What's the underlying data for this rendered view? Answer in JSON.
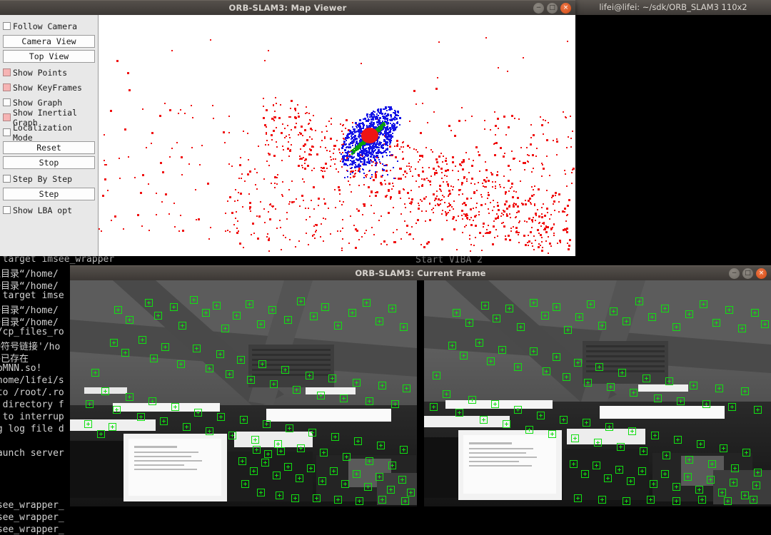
{
  "terminal": {
    "title": "lifei@lifei: ~/sdk/ORB_SLAM3 110x2",
    "lines": [
      ": target imsee_wrapper",
      "入目录“/home/",
      "开目录“/home/",
      ": target imse",
      "开目录“/home/",
      "开目录“/home/",
      "s/cp_files_ro",
      "接符号链接'/ho",
      "件已存在",
      ".bMNN.so!",
      "/home/lifei/s",
      " to /root/.ro",
      "g directory f",
      ": to interrup",
      "ng log file d",
      "Launch server",
      "msee_wrapper_",
      "msee_wrapper_",
      "msee_wrapper_"
    ],
    "background_text": "Start VIBA 2"
  },
  "map_viewer": {
    "title": "ORB-SLAM3: Map Viewer",
    "window_buttons": [
      "minimize",
      "maximize",
      "close"
    ],
    "controls": [
      {
        "type": "checkbox",
        "name": "follow-camera",
        "label": "Follow Camera",
        "checked": false
      },
      {
        "type": "button",
        "name": "camera-view",
        "label": "Camera View"
      },
      {
        "type": "button",
        "name": "top-view",
        "label": "Top View"
      },
      {
        "type": "checkbox",
        "name": "show-points",
        "label": "Show Points",
        "checked": true
      },
      {
        "type": "checkbox",
        "name": "show-keyframes",
        "label": "Show KeyFrames",
        "checked": true
      },
      {
        "type": "checkbox",
        "name": "show-graph",
        "label": "Show Graph",
        "checked": false
      },
      {
        "type": "checkbox",
        "name": "show-inertial-graph",
        "label": "Show Inertial Graph",
        "checked": true
      },
      {
        "type": "checkbox",
        "name": "localization-mode",
        "label": "Localization Mode",
        "checked": false
      },
      {
        "type": "button",
        "name": "reset",
        "label": "Reset"
      },
      {
        "type": "button",
        "name": "stop",
        "label": "Stop"
      },
      {
        "type": "checkbox",
        "name": "step-by-step",
        "label": "Step By Step",
        "checked": false
      },
      {
        "type": "button",
        "name": "step",
        "label": "Step"
      },
      {
        "type": "checkbox",
        "name": "show-lba-opt",
        "label": "Show LBA opt",
        "checked": false
      }
    ],
    "colors": {
      "map_point": "#f01010",
      "keyframe": "#1414e6",
      "graph_edge": "#08a008",
      "current_camera": "#ef1414",
      "canvas_background": "#ffffff",
      "panel_background": "#e8e8e8",
      "checkbox_checked": "#f6b4b4"
    }
  },
  "current_frame": {
    "title": "ORB-SLAM3: Current Frame",
    "window_buttons": [
      "minimize",
      "maximize",
      "close"
    ],
    "views": [
      {
        "name": "left-camera-view"
      },
      {
        "name": "right-camera-view"
      }
    ],
    "keypoint_color": "#11e011",
    "scene": "office ceiling with fluorescent lights and monitors"
  },
  "titlebar_colors": {
    "active_gradient_top": "#55504b",
    "active_gradient_bottom": "#3b3734",
    "title_text": "#d8d4cf",
    "close_button": "#e0521c"
  }
}
